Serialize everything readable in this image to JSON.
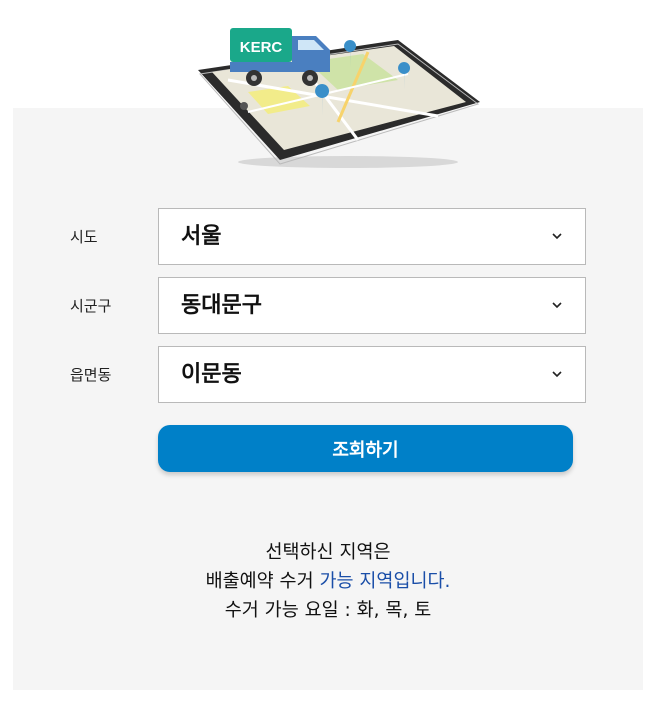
{
  "hero": {
    "truck_badge": "KERC"
  },
  "form": {
    "sido": {
      "label": "시도",
      "value": "서울"
    },
    "sigungu": {
      "label": "시군구",
      "value": "동대문구"
    },
    "eupmyeondong": {
      "label": "읍면동",
      "value": "이문동"
    },
    "search_button": "조회하기"
  },
  "result": {
    "line1": "선택하신 지역은",
    "line2_prefix": "배출예약 수거 ",
    "line2_highlight": "가능 지역입니다.",
    "line3": "수거 가능 요일 : 화, 목, 토"
  },
  "colors": {
    "accent": "#0080c8",
    "highlight": "#1a4ea8",
    "truck_badge": "#1aa88a"
  }
}
